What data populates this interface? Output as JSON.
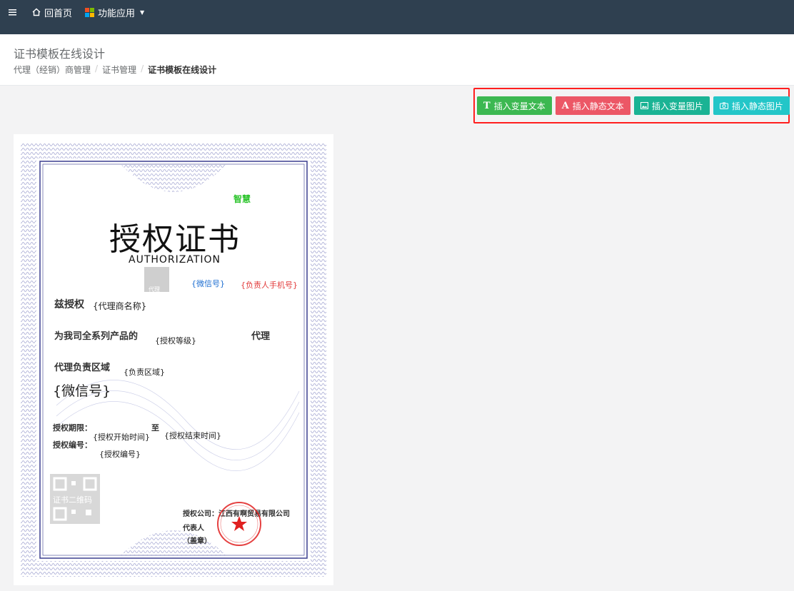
{
  "topbar": {
    "menu_icon": "hamburger-icon",
    "home_label": "回首页",
    "apps_label": "功能应用",
    "colors": {
      "bg": "#2f4050"
    }
  },
  "header": {
    "title": "证书模板在线设计",
    "breadcrumb": [
      "代理（经销）商管理",
      "证书管理",
      "证书模板在线设计"
    ]
  },
  "toolbar": {
    "buttons": [
      {
        "label": "插入变量文本",
        "icon": "T",
        "color": "#3cb851"
      },
      {
        "label": "插入静态文本",
        "icon": "A",
        "color": "#ec5766"
      },
      {
        "label": "插入变量图片",
        "icon": "image-icon",
        "color": "#1ab394"
      },
      {
        "label": "插入静态图片",
        "icon": "camera-icon",
        "color": "#23c6c8"
      }
    ]
  },
  "certificate": {
    "title": "授权证书",
    "subtitle": "AUTHORIZATION",
    "wisdom": "智慧",
    "photo_label": "代理",
    "wechat_var": "{微信号}",
    "phone_var": "{负责人手机号}",
    "hereby": "兹授权",
    "agent_name_var": "{代理商名称}",
    "products": "为我司全系列产品的",
    "level_var": "{授权等级}",
    "agent_suffix": "代理",
    "region": "代理负责区域",
    "region_var": "{负责区域}",
    "wechat_big": "{微信号}",
    "period": "授权期限：",
    "to": "至",
    "start_var": "{授权开始时间}",
    "end_var": "{授权结束时间}",
    "number": "授权编号：",
    "number_var": "{授权编号}",
    "qr_label": "证书二维码",
    "company": "授权公司：江西有啊贸易有限公司",
    "rep": "代表人",
    "seal": "（盖章）"
  }
}
